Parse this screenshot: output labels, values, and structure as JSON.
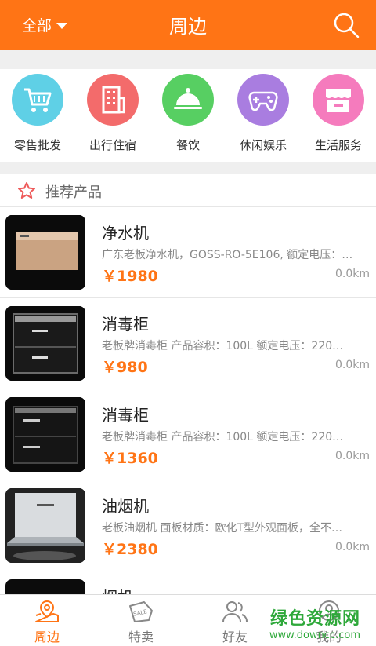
{
  "header": {
    "filter_label": "全部",
    "title": "周边"
  },
  "categories": [
    {
      "label": "零售批发",
      "icon": "shopping-cart-icon",
      "color": "#5fd0e6"
    },
    {
      "label": "出行住宿",
      "icon": "hotel-building-icon",
      "color": "#f36b6b"
    },
    {
      "label": "餐饮",
      "icon": "food-cloche-icon",
      "color": "#57cf62"
    },
    {
      "label": "休闲娱乐",
      "icon": "gamepad-icon",
      "color": "#a97de0"
    },
    {
      "label": "生活服务",
      "icon": "store-icon",
      "color": "#f57bbd"
    }
  ],
  "section": {
    "title": "推荐产品"
  },
  "products": [
    {
      "name": "净水机",
      "desc": "广东老板净水机，GOSS-RO-5E106, 额定电压：…",
      "price": "￥1980",
      "distance": "0.0km"
    },
    {
      "name": "消毒柜",
      "desc": "老板牌消毒柜 产品容积：100L 额定电压：220…",
      "price": "￥980",
      "distance": "0.0km"
    },
    {
      "name": "消毒柜",
      "desc": "老板牌消毒柜 产品容积：100L 额定电压：220…",
      "price": "￥1360",
      "distance": "0.0km"
    },
    {
      "name": "油烟机",
      "desc": "老板油烟机 面板材质：欧化T型外观面板，全不…",
      "price": "￥2380",
      "distance": "0.0km"
    },
    {
      "name": "烟机",
      "desc": "",
      "price": "",
      "distance": ""
    }
  ],
  "tabs": [
    {
      "label": "周边",
      "icon": "map-pin-icon",
      "active": true
    },
    {
      "label": "特卖",
      "icon": "sale-tag-icon",
      "active": false
    },
    {
      "label": "好友",
      "icon": "friends-icon",
      "active": false
    },
    {
      "label": "我的",
      "icon": "profile-icon",
      "active": false
    }
  ],
  "watermark": {
    "line1": "绿色资源网",
    "line2": "www.downcc.com"
  },
  "colors": {
    "accent": "#ff7415",
    "background": "#efefef"
  }
}
